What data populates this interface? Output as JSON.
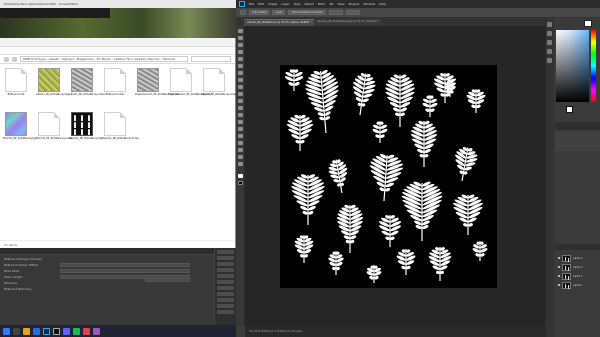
{
  "background_window": {
    "title": "Photoshop-Fern-Alpha-Tutorial-UE5 - Unreal Editor"
  },
  "explorer": {
    "path": "RMM Prototype › Assets › Stylized › Megascans › 3D Plants › Leather Fern (Applied Objects) › Textures",
    "status": "11 items",
    "files": [
      {
        "label": "Billboard.mat",
        "kind": "doc"
      },
      {
        "label": "Albedo_8K_RoltaNucay.tga",
        "kind": "olive"
      },
      {
        "label": "Albedo_8K_RoltaNucay.index",
        "kind": "gray"
      },
      {
        "label": "Billboard.index",
        "kind": "doc"
      },
      {
        "label": "Displacement_8K_RoltaNucay.index",
        "kind": "gray"
      },
      {
        "label": "Displacement_8K_RoltaNucay.mlm",
        "kind": "doc"
      },
      {
        "label": "Albedo_8K_RoltaNucay.index",
        "kind": "doc"
      },
      {
        "label": "Normal_8K_RoltaNucay.tga",
        "kind": "normal"
      },
      {
        "label": "Normal_8K_RoltaNucay.index",
        "kind": "doc"
      },
      {
        "label": "Opacity_8K_RoltaNucay.tga",
        "kind": "fern"
      },
      {
        "label": "Opacity_8K_RoltaNucay.index",
        "kind": "doc"
      }
    ]
  },
  "editor_panel": {
    "rows": [
      "Billboard Ranges (Preset)",
      "Billboard Vertex Offset",
      "Fade Start",
      "Fade Length",
      "Distance",
      "Billboard Blending"
    ]
  },
  "photoshop": {
    "menus": [
      "File",
      "Edit",
      "Image",
      "Layer",
      "Type",
      "Select",
      "Filter",
      "3D",
      "View",
      "Plugins",
      "Window",
      "Help"
    ],
    "options": [
      "Auto-Select",
      "Layer",
      "Show Transform Controls"
    ],
    "tabs": [
      {
        "label": "Albedo_8K_RoltaNucay @ 33.3% (Alpha, RGB/8) *",
        "active": true
      },
      {
        "label": "Opacity_8K_RoltaNucay.tga @ 33.3% (Gray/8) *",
        "active": false
      }
    ],
    "status": "33.33%   8192 px x 8192 px (72 ppi)",
    "layers": [
      "Alpha 4",
      "Alpha 3",
      "Alpha 2",
      "Alpha 1"
    ]
  }
}
